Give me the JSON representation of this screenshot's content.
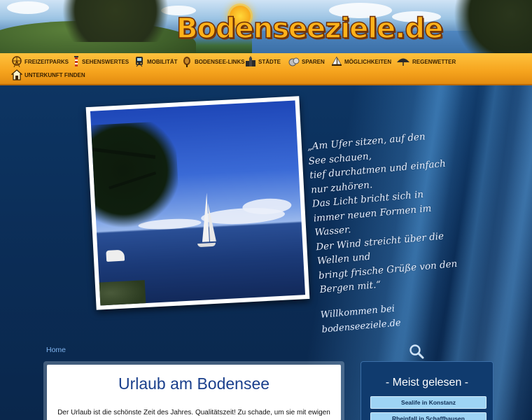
{
  "header": {
    "logo_text": "Bodenseeziele.de"
  },
  "nav": {
    "items": [
      {
        "label": "Freizeitparks",
        "icon": "ferris-wheel-icon"
      },
      {
        "label": "Sehenswertes",
        "icon": "lighthouse-icon"
      },
      {
        "label": "Mobilität",
        "icon": "train-icon"
      },
      {
        "label": "Bodensee-Links",
        "icon": "link-sign-icon"
      },
      {
        "label": "Städte",
        "icon": "city-icon"
      },
      {
        "label": "Sparen",
        "icon": "coins-icon"
      },
      {
        "label": "Möglichkeiten",
        "icon": "sailboat-icon"
      },
      {
        "label": "Regenwetter",
        "icon": "umbrella-icon"
      },
      {
        "label": "Unterkunft finden",
        "icon": "house-icon"
      }
    ]
  },
  "hero": {
    "quote": "„Am Ufer sitzen, auf den\nSee schauen,\ntief durchatmen und einfach\nnur zuhören.\nDas Licht bricht sich in\nimmer neuen Formen im\nWasser.\nDer Wind streicht über die\nWellen und\nbringt frische Grüße von den\nBergen mit.“",
    "signature": "Willkommen bei\nbodenseeziele.de"
  },
  "breadcrumb": {
    "home_label": "Home"
  },
  "main": {
    "title": "Urlaub am Bodensee",
    "intro": "Der Urlaub ist die schönste Zeit des Jahres. Qualitätszeit! Zu schade, um sie mit ewigen"
  },
  "sidebar": {
    "title": "- Meist gelesen -",
    "links": [
      {
        "label": "Sealife in Konstanz"
      },
      {
        "label": "Rheinfall in Schaffhausen"
      }
    ]
  },
  "colors": {
    "nav_bg": "#f5a31d",
    "hero_bg": "#0b2f5c",
    "title_blue": "#1a3f8c",
    "sidebar_link_bg": "#9ed4f4"
  }
}
